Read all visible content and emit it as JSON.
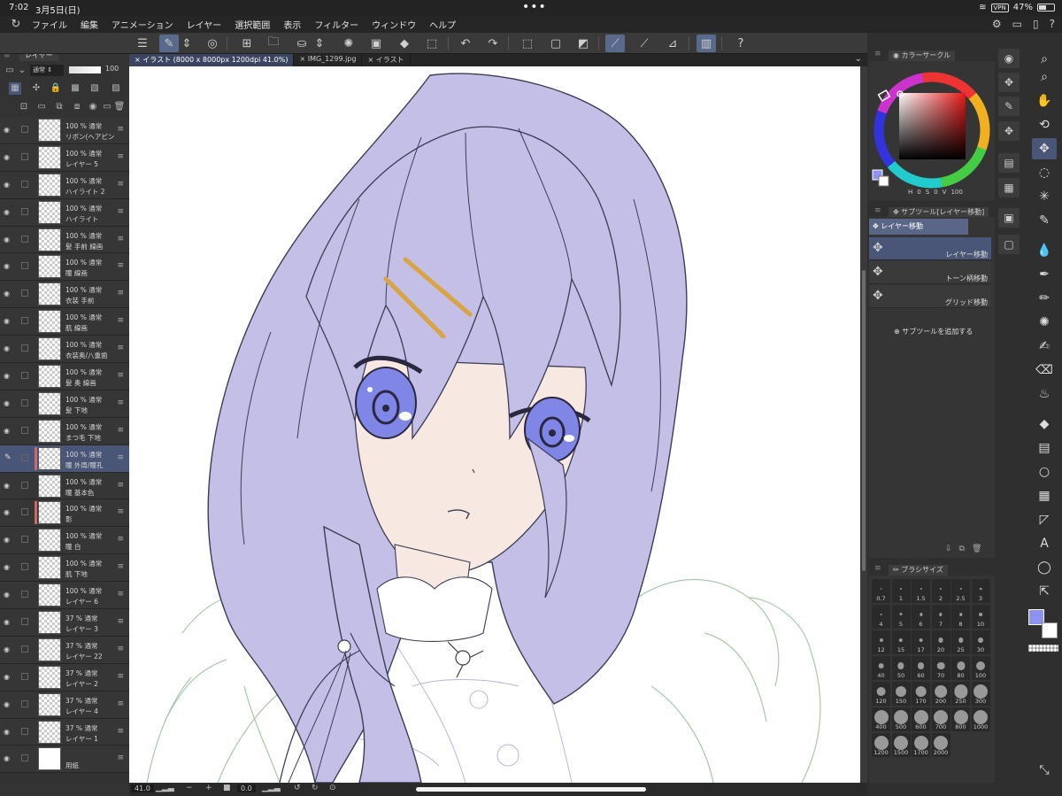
{
  "status": {
    "time": "7:02",
    "date": "3月5日(日)",
    "vpn": "VPN",
    "battery": "47%"
  },
  "menu": [
    "ファイル",
    "編集",
    "アニメーション",
    "レイヤー",
    "選択範囲",
    "表示",
    "フィルター",
    "ウィンドウ",
    "ヘルプ"
  ],
  "tabs": [
    {
      "label": "× イラスト (8000 x 8000px 1200dpi 41.0%)",
      "active": true
    },
    {
      "label": "× IMG_1299.jpg",
      "active": false
    },
    {
      "label": "× イラスト",
      "active": false
    }
  ],
  "layer_panel": {
    "title": "レイヤー",
    "blend_mode": "通常",
    "opacity": "100"
  },
  "layers": [
    {
      "pct": "100 % 通常",
      "name": "リボン(ヘアピン",
      "selected": false
    },
    {
      "pct": "100 % 通常",
      "name": "レイヤー 5",
      "selected": false
    },
    {
      "pct": "100 % 通常",
      "name": "ハイライト 2",
      "selected": false
    },
    {
      "pct": "100 % 通常",
      "name": "ハイライト",
      "selected": false
    },
    {
      "pct": "100 % 通常",
      "name": "髪 手前 線画",
      "selected": false
    },
    {
      "pct": "100 % 通常",
      "name": "瞳 線画",
      "selected": false
    },
    {
      "pct": "100 % 通常",
      "name": "衣装 手前",
      "selected": false
    },
    {
      "pct": "100 % 通常",
      "name": "肌 線画",
      "selected": false
    },
    {
      "pct": "100 % 通常",
      "name": "衣装奥/八重歯",
      "selected": false
    },
    {
      "pct": "100 % 通常",
      "name": "髪 奥 線画",
      "selected": false
    },
    {
      "pct": "100 % 通常",
      "name": "髪 下地",
      "selected": false
    },
    {
      "pct": "100 % 通常",
      "name": "まつ毛 下地",
      "selected": false
    },
    {
      "pct": "100 % 通常",
      "name": "瞳 外周/瞳孔",
      "selected": true
    },
    {
      "pct": "100 % 通常",
      "name": "瞳 基本色",
      "selected": false
    },
    {
      "pct": "100 % 通常",
      "name": "影",
      "selected": false
    },
    {
      "pct": "100 % 通常",
      "name": "瞳 白",
      "selected": false
    },
    {
      "pct": "100 % 通常",
      "name": "肌 下地",
      "selected": false
    },
    {
      "pct": "100 % 通常",
      "name": "レイヤー 6",
      "selected": false
    },
    {
      "pct": "37 % 通常",
      "name": "レイヤー 3",
      "selected": false
    },
    {
      "pct": "37 % 通常",
      "name": "レイヤー 22",
      "selected": false
    },
    {
      "pct": "37 % 通常",
      "name": "レイヤー 2",
      "selected": false
    },
    {
      "pct": "37 % 通常",
      "name": "レイヤー 4",
      "selected": false
    },
    {
      "pct": "37 % 通常",
      "name": "レイヤー 1",
      "selected": false
    },
    {
      "pct": "",
      "name": "用紙",
      "selected": false
    }
  ],
  "color_panel": {
    "title": "カラーサークル",
    "h": "0",
    "s": "0",
    "v": "100",
    "h_label": "H",
    "s_label": "S",
    "v_label": "V"
  },
  "subtool_panel": {
    "title": "サブツール[レイヤー移動]",
    "group": "レイヤー移動",
    "items": [
      "レイヤー移動",
      "トーン柄移動",
      "グリッド移動"
    ],
    "add_label": "サブツールを追加する"
  },
  "brush_panel": {
    "title": "ブラシサイズ",
    "sizes": [
      "0.7",
      "1",
      "1.5",
      "2",
      "2.5",
      "3",
      "4",
      "5",
      "6",
      "7",
      "8",
      "10",
      "12",
      "15",
      "17",
      "20",
      "25",
      "30",
      "40",
      "50",
      "60",
      "70",
      "80",
      "100",
      "120",
      "150",
      "170",
      "200",
      "250",
      "300",
      "400",
      "500",
      "600",
      "700",
      "800",
      "1000",
      "1200",
      "1500",
      "1700",
      "2000"
    ]
  },
  "bottom": {
    "zoom": "41.0",
    "angle": "0.0"
  },
  "colors": {
    "accent": "#4a5677",
    "main_color": "#8c93f0",
    "sub_color": "#ffffff",
    "hair": "#c3bfe6",
    "skin": "#f7e9e1",
    "eye": "#7f86e6"
  }
}
